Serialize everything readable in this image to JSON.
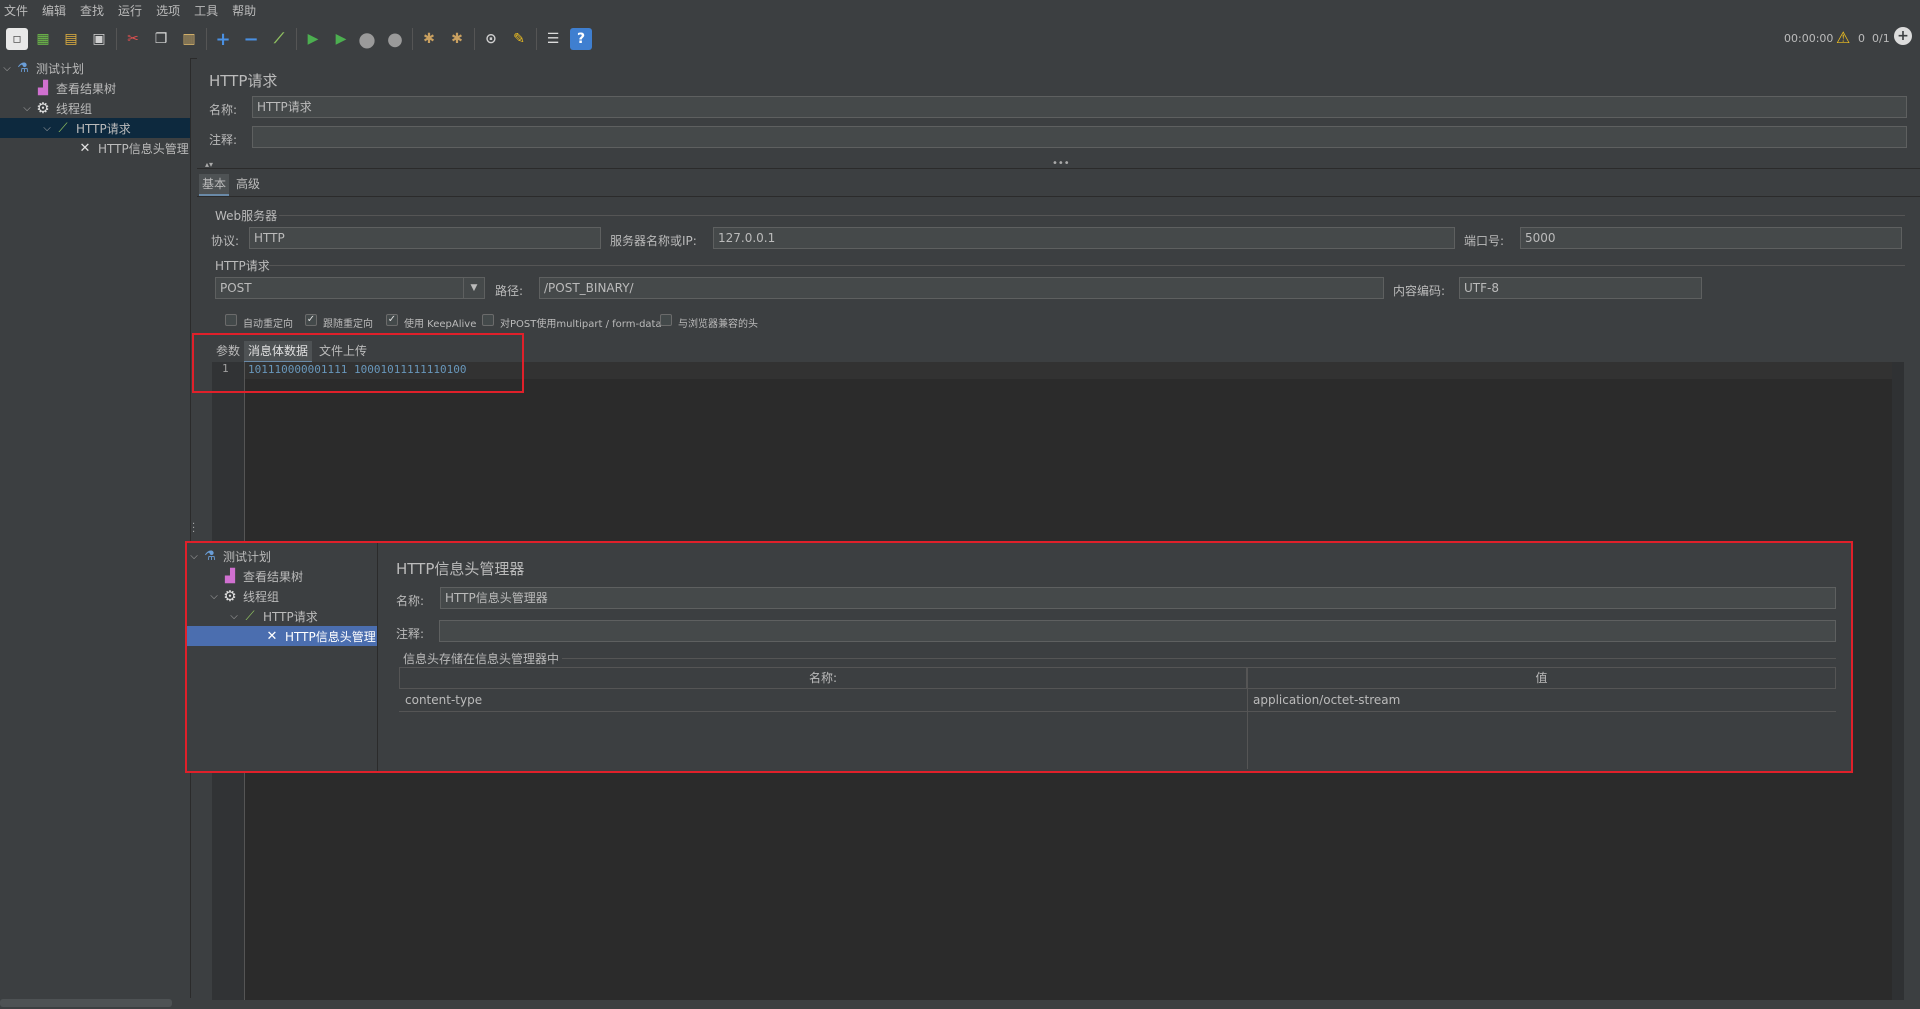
{
  "menu": [
    "文件",
    "编辑",
    "查找",
    "运行",
    "选项",
    "工具",
    "帮助"
  ],
  "toolbar": {
    "timer": "00:00:00",
    "warnings": "0",
    "threads": "0/1"
  },
  "tree": {
    "items": [
      {
        "label": "测试计划",
        "icon": "flask-icon"
      },
      {
        "label": "查看结果树",
        "icon": "chart-icon"
      },
      {
        "label": "线程组",
        "icon": "gear-icon"
      },
      {
        "label": "HTTP请求",
        "icon": "pipette-icon"
      },
      {
        "label": "HTTP信息头管理",
        "icon": "tools-icon"
      }
    ]
  },
  "request": {
    "title": "HTTP请求",
    "name_label": "名称:",
    "name_value": "HTTP请求",
    "comment_label": "注释:",
    "comment_value": "",
    "tabs": [
      "基本",
      "高级"
    ],
    "web_server_group": "Web服务器",
    "protocol_label": "协议:",
    "protocol_value": "HTTP",
    "server_label": "服务器名称或IP:",
    "server_value": "127.0.0.1",
    "port_label": "端口号:",
    "port_value": "5000",
    "http_group": "HTTP请求",
    "method_value": "POST",
    "path_label": "路径:",
    "path_value": "/POST_BINARY/",
    "encoding_label": "内容编码:",
    "encoding_value": "UTF-8",
    "checkboxes": [
      {
        "label": "自动重定向",
        "checked": false
      },
      {
        "label": "跟随重定向",
        "checked": true
      },
      {
        "label": "使用 KeepAlive",
        "checked": true
      },
      {
        "label": "对POST使用multipart / form-data",
        "checked": false
      },
      {
        "label": "与浏览器兼容的头",
        "checked": false
      }
    ],
    "body_tabs": [
      "参数",
      "消息体数据",
      "文件上传"
    ],
    "body_line_number": "1",
    "body_text": "101110000001111 10001011111110100"
  },
  "header_manager": {
    "tree": [
      {
        "label": "测试计划",
        "icon": "flask-icon"
      },
      {
        "label": "查看结果树",
        "icon": "chart-icon"
      },
      {
        "label": "线程组",
        "icon": "gear-icon"
      },
      {
        "label": "HTTP请求",
        "icon": "pipette-icon"
      },
      {
        "label": "HTTP信息头管理",
        "icon": "tools-icon"
      }
    ],
    "title": "HTTP信息头管理器",
    "name_label": "名称:",
    "name_value": "HTTP信息头管理器",
    "comment_label": "注释:",
    "comment_value": "",
    "group_label": "信息头存储在信息头管理器中",
    "columns": [
      "名称:",
      "值"
    ],
    "rows": [
      {
        "name": "content-type",
        "value": "application/octet-stream"
      }
    ]
  },
  "colors": {
    "background": "#3c3f41",
    "field": "#45494a",
    "editor": "#2b2b2b",
    "highlight": "#e0202a",
    "selection": "#4b6eaf"
  }
}
